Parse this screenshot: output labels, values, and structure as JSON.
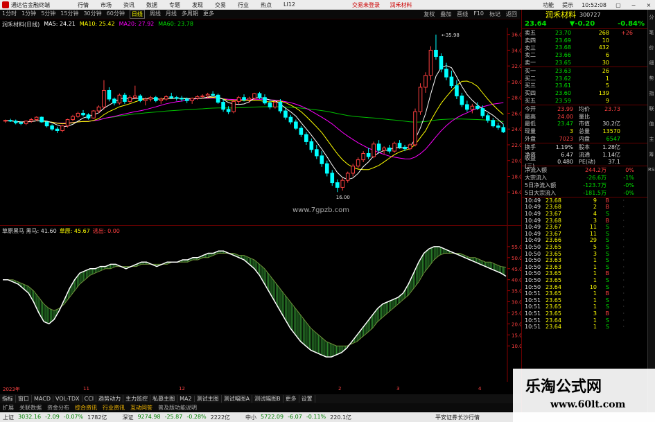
{
  "titlebar": {
    "app_title": "通达信金融终端",
    "menu": [
      "行情",
      "市场",
      "资讯",
      "数据",
      "专题",
      "发现",
      "交易",
      "行业",
      "热点",
      "LI12"
    ],
    "promo": [
      "交易未登录",
      "润禾材料"
    ],
    "right": [
      "功能",
      "提示",
      "10:52:08"
    ],
    "window_controls": [
      "▢",
      "−",
      "×"
    ]
  },
  "periodbar": {
    "periods": [
      "1分时",
      "1分钟",
      "5分钟",
      "15分钟",
      "30分钟",
      "60分钟",
      "日线",
      "周线",
      "月线",
      "多周期",
      "更多"
    ],
    "active": "日线",
    "right": [
      "复权",
      "叠加",
      "画线",
      "F10",
      "标记",
      "返回"
    ]
  },
  "ma_legend": {
    "title": "润禾材料(日线)",
    "items": [
      {
        "label": "MA5: 24.21",
        "color": "#ffffff"
      },
      {
        "label": "MA10: 25.42",
        "color": "#ffff00"
      },
      {
        "label": "MA20: 27.92",
        "color": "#ff00ff"
      },
      {
        "label": "MA60: 23.78",
        "color": "#00e000"
      }
    ]
  },
  "sub_legend": {
    "items": [
      {
        "label": "草原黑马 黑马: 41.60",
        "color": "#dddddd"
      },
      {
        "label": "草原: 45.67",
        "color": "#ffff00"
      },
      {
        "label": "逃出: 0.00",
        "color": "#ff4040"
      }
    ]
  },
  "watermark_small": "www.7gpzb.com",
  "chart_data": [
    {
      "type": "candlestick",
      "title": "润禾材料(日线)",
      "ylim": [
        14.0,
        36.5
      ],
      "yticks": [
        "36.00",
        "34.00",
        "32.00",
        "30.00",
        "28.00",
        "26.00",
        "24.00",
        "22.00",
        "20.00",
        "18.00",
        "16.00"
      ],
      "annotations": [
        {
          "text": "35.98"
        },
        {
          "text": "16.00"
        }
      ],
      "ohlc": [
        [
          25.0,
          25.2,
          24.8,
          25.1
        ],
        [
          25.1,
          25.3,
          24.9,
          25.0
        ],
        [
          25.0,
          25.2,
          24.6,
          24.8
        ],
        [
          24.8,
          25.0,
          24.5,
          24.7
        ],
        [
          24.7,
          25.1,
          24.5,
          25.0
        ],
        [
          25.0,
          25.4,
          24.8,
          25.2
        ],
        [
          25.2,
          25.6,
          25.0,
          25.5
        ],
        [
          25.5,
          25.6,
          24.8,
          24.9
        ],
        [
          24.9,
          25.0,
          24.2,
          24.4
        ],
        [
          24.4,
          24.6,
          23.8,
          24.0
        ],
        [
          24.0,
          24.3,
          23.5,
          23.8
        ],
        [
          23.8,
          24.5,
          23.6,
          24.4
        ],
        [
          24.4,
          25.3,
          24.2,
          25.2
        ],
        [
          25.2,
          25.8,
          25.0,
          25.6
        ],
        [
          25.6,
          26.2,
          25.4,
          26.0
        ],
        [
          26.0,
          26.4,
          25.6,
          25.8
        ],
        [
          25.8,
          26.0,
          25.2,
          25.4
        ],
        [
          25.4,
          26.4,
          25.3,
          26.3
        ],
        [
          26.3,
          27.0,
          26.0,
          26.8
        ],
        [
          26.8,
          30.2,
          26.5,
          28.9
        ],
        [
          28.9,
          29.3,
          27.5,
          27.8
        ],
        [
          27.8,
          28.0,
          27.0,
          27.3
        ],
        [
          27.3,
          28.5,
          27.1,
          28.3
        ],
        [
          28.3,
          28.6,
          27.2,
          27.5
        ],
        [
          27.5,
          28.3,
          27.3,
          28.0
        ],
        [
          28.0,
          29.5,
          27.8,
          28.2
        ],
        [
          28.2,
          28.4,
          27.4,
          27.6
        ],
        [
          27.6,
          28.0,
          27.0,
          27.8
        ],
        [
          27.8,
          28.2,
          27.5,
          28.0
        ],
        [
          28.0,
          28.2,
          27.4,
          27.6
        ],
        [
          27.6,
          28.0,
          27.2,
          27.8
        ],
        [
          27.8,
          28.3,
          27.6,
          28.1
        ],
        [
          28.1,
          28.6,
          27.8,
          28.0
        ],
        [
          28.0,
          28.2,
          27.6,
          27.9
        ],
        [
          27.9,
          28.2,
          27.5,
          27.8
        ],
        [
          27.8,
          28.0,
          27.3,
          27.6
        ],
        [
          27.6,
          28.0,
          27.2,
          27.9
        ],
        [
          27.9,
          28.3,
          27.7,
          28.1
        ],
        [
          28.1,
          28.4,
          27.9,
          28.2
        ],
        [
          28.2,
          28.6,
          28.0,
          28.4
        ],
        [
          28.4,
          28.8,
          28.1,
          28.3
        ],
        [
          28.3,
          28.5,
          27.2,
          27.4
        ],
        [
          27.4,
          27.8,
          26.2,
          26.5
        ],
        [
          26.5,
          26.9,
          25.9,
          26.2
        ],
        [
          26.2,
          27.8,
          26.0,
          27.5
        ],
        [
          27.5,
          28.2,
          27.2,
          28.0
        ],
        [
          28.0,
          28.4,
          27.5,
          27.7
        ],
        [
          27.7,
          28.1,
          27.3,
          27.9
        ],
        [
          27.9,
          28.6,
          27.7,
          28.5
        ],
        [
          28.5,
          28.7,
          27.8,
          28.0
        ],
        [
          28.0,
          28.4,
          27.1,
          27.3
        ],
        [
          27.3,
          27.6,
          26.5,
          26.8
        ],
        [
          26.8,
          27.6,
          26.6,
          27.4
        ],
        [
          27.4,
          27.8,
          26.0,
          26.3
        ],
        [
          26.3,
          26.6,
          25.2,
          25.5
        ],
        [
          25.5,
          25.8,
          24.6,
          24.9
        ],
        [
          24.9,
          25.2,
          23.9,
          24.1
        ],
        [
          24.1,
          24.4,
          23.0,
          23.3
        ],
        [
          23.3,
          23.6,
          22.0,
          22.4
        ],
        [
          22.4,
          22.8,
          21.0,
          21.4
        ],
        [
          21.4,
          22.0,
          20.2,
          20.6
        ],
        [
          20.6,
          21.2,
          19.2,
          19.6
        ],
        [
          19.6,
          20.0,
          18.0,
          18.4
        ],
        [
          18.4,
          18.8,
          16.8,
          17.2
        ],
        [
          17.2,
          17.6,
          16.0,
          16.6
        ],
        [
          16.6,
          17.8,
          16.2,
          17.5
        ],
        [
          17.5,
          18.6,
          17.2,
          18.4
        ],
        [
          18.4,
          19.6,
          18.0,
          19.3
        ],
        [
          19.3,
          20.4,
          19.0,
          20.1
        ],
        [
          20.1,
          21.2,
          19.8,
          20.9
        ],
        [
          20.9,
          21.6,
          20.2,
          20.5
        ],
        [
          20.5,
          22.4,
          20.3,
          22.1
        ],
        [
          22.1,
          22.6,
          21.0,
          21.3
        ],
        [
          21.3,
          21.8,
          20.8,
          21.6
        ],
        [
          21.6,
          22.0,
          20.9,
          21.2
        ],
        [
          21.2,
          22.4,
          21.0,
          22.2
        ],
        [
          22.2,
          22.6,
          21.5,
          21.7
        ],
        [
          21.7,
          22.0,
          21.2,
          21.5
        ],
        [
          21.5,
          22.2,
          21.3,
          22.0
        ],
        [
          22.0,
          26.6,
          21.8,
          26.2
        ],
        [
          26.2,
          29.8,
          25.8,
          29.3
        ],
        [
          29.3,
          31.2,
          28.6,
          30.8
        ],
        [
          30.8,
          34.5,
          30.2,
          34.0
        ],
        [
          34.0,
          35.98,
          32.8,
          33.2
        ],
        [
          33.2,
          33.6,
          31.2,
          31.6
        ],
        [
          31.6,
          32.4,
          30.2,
          30.6
        ],
        [
          30.6,
          31.4,
          29.2,
          29.5
        ],
        [
          29.5,
          30.2,
          27.8,
          28.2
        ],
        [
          28.2,
          28.6,
          26.8,
          27.1
        ],
        [
          27.1,
          27.6,
          26.2,
          26.5
        ],
        [
          26.5,
          27.2,
          26.0,
          26.9
        ],
        [
          26.9,
          27.4,
          26.4,
          26.6
        ],
        [
          26.6,
          27.0,
          25.4,
          25.7
        ],
        [
          25.7,
          26.0,
          24.8,
          25.1
        ],
        [
          25.1,
          25.4,
          24.2,
          24.4
        ],
        [
          24.4,
          24.8,
          23.9,
          24.2
        ],
        [
          24.2,
          24.6,
          23.5,
          23.64
        ]
      ]
    },
    {
      "type": "area",
      "title": "草原黑马",
      "ylim": [
        0,
        60
      ],
      "yticks": [
        "55.00",
        "50.00",
        "45.00",
        "40.00",
        "35.00",
        "30.00",
        "25.00",
        "20.00",
        "15.00",
        "10.00"
      ],
      "series": [
        {
          "name": "黑马",
          "values": [
            40,
            40,
            39,
            38,
            36,
            34,
            30,
            25,
            21,
            20,
            22,
            26,
            31,
            36,
            40,
            43,
            44,
            45,
            45,
            46,
            46,
            47,
            47,
            46,
            45,
            46,
            47,
            48,
            48,
            47,
            46,
            47,
            48,
            48,
            48,
            49,
            49,
            50,
            50,
            51,
            52,
            52,
            53,
            53,
            52,
            51,
            50,
            49,
            47,
            45,
            42,
            38,
            34,
            30,
            26,
            22,
            18,
            15,
            12,
            10,
            8,
            7,
            6,
            5,
            5,
            6,
            7,
            9,
            12,
            15,
            18,
            21,
            24,
            27,
            29,
            30,
            31,
            32,
            34,
            38,
            43,
            48,
            52,
            54,
            55,
            55,
            54,
            53,
            52,
            51,
            50,
            49,
            48,
            47,
            46,
            45,
            44,
            43,
            41.6
          ]
        },
        {
          "name": "草原",
          "values": [
            40,
            40,
            40,
            39,
            38,
            37,
            35,
            32,
            29,
            27,
            26,
            27,
            29,
            32,
            35,
            38,
            40,
            42,
            43,
            44,
            45,
            45,
            46,
            46,
            46,
            46,
            46,
            47,
            47,
            47,
            47,
            47,
            47,
            48,
            48,
            48,
            48,
            49,
            49,
            50,
            50,
            51,
            52,
            52,
            52,
            52,
            51,
            51,
            50,
            49,
            47,
            45,
            42,
            39,
            36,
            33,
            30,
            27,
            24,
            21,
            18,
            16,
            14,
            12,
            11,
            10,
            10,
            10,
            11,
            12,
            14,
            16,
            18,
            21,
            23,
            25,
            27,
            29,
            31,
            33,
            36,
            39,
            43,
            46,
            49,
            51,
            52,
            52,
            52,
            52,
            51,
            50,
            50,
            49,
            48,
            48,
            47,
            46,
            45.67
          ]
        }
      ]
    }
  ],
  "datebar": [
    "2023年",
    "11",
    "12",
    "2",
    "3",
    "4"
  ],
  "indicator_tabs": [
    "指标",
    "窗口",
    "MACD",
    "VOL-TDX",
    "CCI",
    "趋势动力",
    "主力监控",
    "私募主图",
    "MA2",
    "测试主图",
    "测试幅图A",
    "测试幅图B",
    "更多",
    "设置"
  ],
  "info_tabs": [
    {
      "label": "扩展",
      "hl": false
    },
    {
      "label": "关联数据",
      "hl": false
    },
    {
      "label": "资金分布",
      "hl": false
    },
    {
      "label": "综合资讯",
      "hl": true
    },
    {
      "label": "行业资讯",
      "hl": true
    },
    {
      "label": "互动问答",
      "hl": true
    },
    {
      "label": "普及版功能说明",
      "hl": false
    }
  ],
  "statusbar": [
    {
      "label": "上证",
      "price": "3032.16",
      "chg": "-2.09",
      "pct": "-0.07%",
      "amt": "1782亿"
    },
    {
      "label": "深证",
      "price": "9274.98",
      "chg": "-25.87",
      "pct": "-0.28%",
      "amt": "2222亿"
    },
    {
      "label": "中小",
      "price": "5722.09",
      "chg": "-6.07",
      "pct": "-0.11%",
      "amt": "220.1亿"
    }
  ],
  "statusbar_right": "平安证券长沙行情",
  "quote": {
    "name": "润禾材料",
    "code": "300727",
    "price": "23.64",
    "change": "▼-0.20",
    "pct": "-0.84%",
    "asks": [
      {
        "l": "卖五",
        "p": "23.70",
        "v": "268",
        "x": "+26"
      },
      {
        "l": "卖四",
        "p": "23.69",
        "v": "10",
        "x": ""
      },
      {
        "l": "卖三",
        "p": "23.68",
        "v": "432",
        "x": ""
      },
      {
        "l": "卖二",
        "p": "23.66",
        "v": "6",
        "x": ""
      },
      {
        "l": "卖一",
        "p": "23.65",
        "v": "30",
        "x": ""
      }
    ],
    "bids": [
      {
        "l": "买一",
        "p": "23.63",
        "v": "26",
        "x": ""
      },
      {
        "l": "买二",
        "p": "23.62",
        "v": "1",
        "x": ""
      },
      {
        "l": "买三",
        "p": "23.61",
        "v": "5",
        "x": ""
      },
      {
        "l": "买四",
        "p": "23.60",
        "v": "139",
        "x": ""
      },
      {
        "l": "买五",
        "p": "23.59",
        "v": "9",
        "x": ""
      }
    ],
    "stats": [
      {
        "l1": "今开",
        "v1": "23.99",
        "c1": "r",
        "l2": "均价",
        "v2": "23.73",
        "c2": "r"
      },
      {
        "l1": "最高",
        "v1": "24.00",
        "c1": "r",
        "l2": "量比",
        "v2": "",
        "c2": "w"
      },
      {
        "l1": "最低",
        "v1": "23.47",
        "c1": "g",
        "l2": "市值",
        "v2": "30.2亿",
        "c2": "w"
      },
      {
        "l1": "现量",
        "v1": "3",
        "c1": "y",
        "l2": "总量",
        "v2": "13570",
        "c2": "y"
      },
      {
        "l1": "外盘",
        "v1": "7023",
        "c1": "r",
        "l2": "内盘",
        "v2": "6547",
        "c2": "g"
      }
    ],
    "stats2": [
      {
        "l1": "换手",
        "v1": "1.19%",
        "c1": "w",
        "l2": "股本",
        "v2": "1.28亿",
        "c2": "w"
      },
      {
        "l1": "净资",
        "v1": "6.47",
        "c1": "w",
        "l2": "流通",
        "v2": "1.14亿",
        "c2": "w"
      },
      {
        "l1": "收益(三)",
        "v1": "0.480",
        "c1": "w",
        "l2": "PE(动)",
        "v2": "37.1",
        "c2": "w"
      }
    ],
    "flows": [
      {
        "l": "净流入额",
        "v": "244.2万",
        "p": "0%",
        "c": "r"
      },
      {
        "l": "大宗流入",
        "v": "-26.6万",
        "p": "-1%",
        "c": "g"
      },
      {
        "l": "5日净流入额",
        "v": "-123.7万",
        "p": "-0%",
        "c": "g"
      },
      {
        "l": "5日大宗流入",
        "v": "-181.5万",
        "p": "-0%",
        "c": "g"
      }
    ],
    "ticks": [
      {
        "t": "10:49",
        "p": "23.68",
        "v": "9",
        "b": "B"
      },
      {
        "t": "10:49",
        "p": "23.68",
        "v": "2",
        "b": "B"
      },
      {
        "t": "10:49",
        "p": "23.67",
        "v": "4",
        "b": "S"
      },
      {
        "t": "10:49",
        "p": "23.68",
        "v": "3",
        "b": "B"
      },
      {
        "t": "10:49",
        "p": "23.67",
        "v": "11",
        "b": "S"
      },
      {
        "t": "10:49",
        "p": "23.67",
        "v": "11",
        "b": "S"
      },
      {
        "t": "10:49",
        "p": "23.66",
        "v": "29",
        "b": "S"
      },
      {
        "t": "10:50",
        "p": "23.65",
        "v": "5",
        "b": "S"
      },
      {
        "t": "10:50",
        "p": "23.65",
        "v": "3",
        "b": "S"
      },
      {
        "t": "10:50",
        "p": "23.63",
        "v": "1",
        "b": "S"
      },
      {
        "t": "10:50",
        "p": "23.63",
        "v": "1",
        "b": "S"
      },
      {
        "t": "10:50",
        "p": "23.65",
        "v": "1",
        "b": "B"
      },
      {
        "t": "10:50",
        "p": "23.65",
        "v": "1",
        "b": "S"
      },
      {
        "t": "10:50",
        "p": "23.64",
        "v": "10",
        "b": "S"
      },
      {
        "t": "10:51",
        "p": "23.65",
        "v": "1",
        "b": "B"
      },
      {
        "t": "10:51",
        "p": "23.65",
        "v": "1",
        "b": "S"
      },
      {
        "t": "10:51",
        "p": "23.65",
        "v": "1",
        "b": "S"
      },
      {
        "t": "10:51",
        "p": "23.65",
        "v": "3",
        "b": "B"
      },
      {
        "t": "10:51",
        "p": "23.64",
        "v": "1",
        "b": "S"
      },
      {
        "t": "10:51",
        "p": "23.64",
        "v": "1",
        "b": "S"
      }
    ]
  },
  "sidetabs": [
    "分",
    "笔",
    "价",
    "细",
    "势",
    "指",
    "联",
    "值",
    "主",
    "筹",
    "RSI"
  ],
  "big_watermark": {
    "line1": "乐淘公式网",
    "line2": "www.60lt.com"
  },
  "colors": {
    "up": "#ff4040",
    "down": "#00ffff",
    "ma5": "#ffffff",
    "ma10": "#ffff00",
    "ma20": "#ff00ff",
    "ma60": "#00c000",
    "hm_fill": "#2e8b2e"
  }
}
